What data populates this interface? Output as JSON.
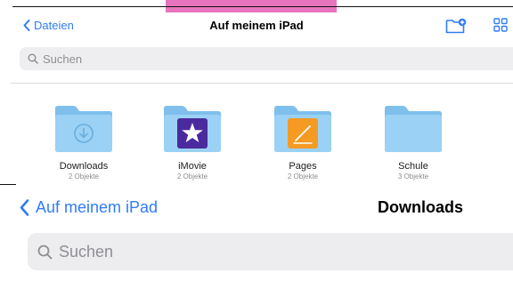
{
  "top_screen": {
    "nav": {
      "back_label": "Dateien",
      "title": "Auf meinem iPad"
    },
    "search": {
      "placeholder": "Suchen"
    },
    "folders": [
      {
        "name": "Downloads",
        "count": "2 Objekte",
        "icon": "download-arrow-icon"
      },
      {
        "name": "iMovie",
        "count": "2 Objekte",
        "icon": "imovie-star-icon"
      },
      {
        "name": "Pages",
        "count": "2 Objekte",
        "icon": "pages-pen-icon"
      },
      {
        "name": "Schule",
        "count": "3 Objekte",
        "icon": "plain-folder-icon"
      }
    ]
  },
  "bottom_screen": {
    "nav": {
      "back_label": "Auf meinem iPad",
      "title": "Downloads"
    },
    "search": {
      "placeholder": "Suchen"
    }
  },
  "colors": {
    "accent": "#2f7cf6",
    "folder_back": "#7fbfec",
    "folder_front": "#9ad1f5",
    "imovie": "#4b2a9e",
    "pages": "#f59a23",
    "pink_strip": "#e775bd"
  }
}
